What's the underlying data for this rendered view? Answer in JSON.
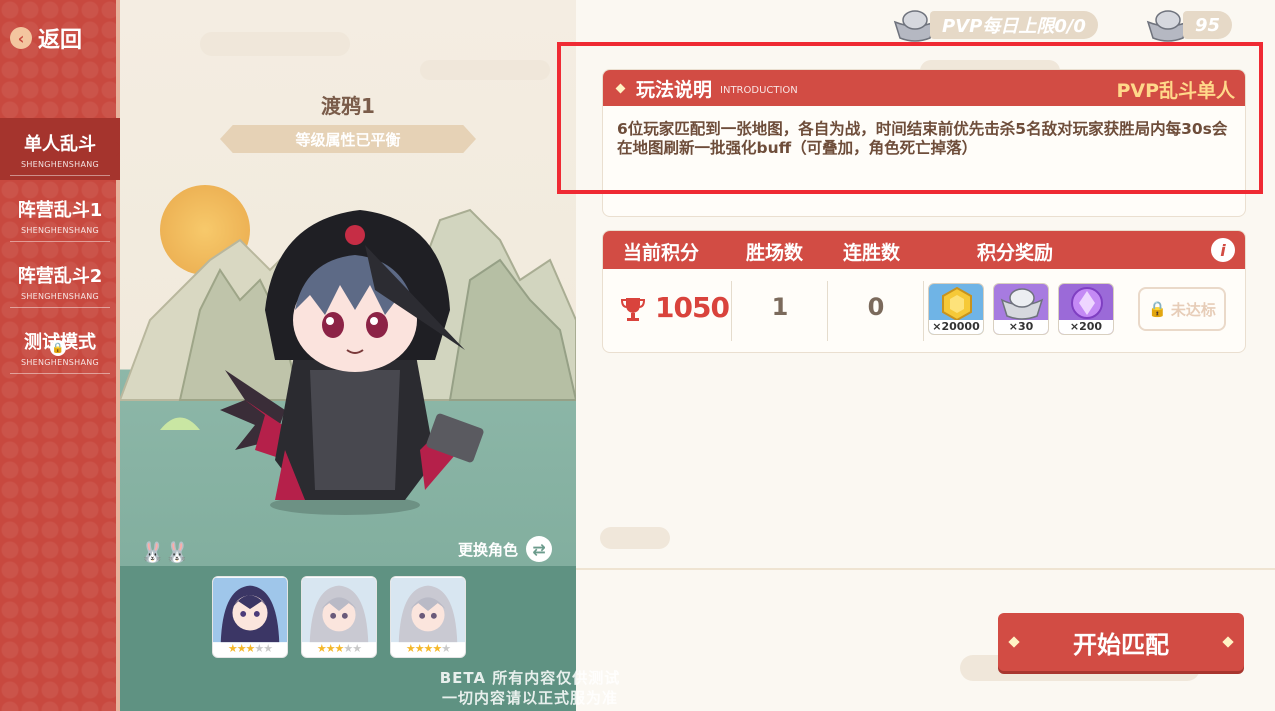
{
  "sidebar": {
    "back_label": "返回",
    "modes": [
      {
        "label": "单人乱斗",
        "sub": "SHENGHENSHANG",
        "active": true
      },
      {
        "label": "阵营乱斗1",
        "sub": "SHENGHENSHANG",
        "active": false
      },
      {
        "label": "阵营乱斗2",
        "sub": "SHENGHENSHANG",
        "active": false
      },
      {
        "label": "测试模式",
        "sub": "SHENGHENSHANG",
        "active": false,
        "locked": true
      }
    ]
  },
  "character": {
    "name": "渡鸦1",
    "balance_note": "等级属性已平衡",
    "switch_label": "更换角色",
    "roster": [
      {
        "stars_on": 3,
        "stars_total": 5
      },
      {
        "stars_on": 3,
        "stars_total": 5
      },
      {
        "stars_on": 4,
        "stars_total": 5
      }
    ]
  },
  "watermark": {
    "line1": "BETA 所有内容仅供测试",
    "line2": "一切内容请以正式服为准"
  },
  "currency": {
    "pvp_limit": "PVP每日上限0/0",
    "silver": "95"
  },
  "intro": {
    "title": "玩法说明",
    "subtitle": "INTRODUCTION",
    "mode": "PVP乱斗单人",
    "text": "6位玩家匹配到一张地图，各自为战，时间结束前优先击杀5名敌对玩家获胜局内每30s会在地图刷新一批强化buff（可叠加，角色死亡掉落）"
  },
  "score": {
    "headers": {
      "points": "当前积分",
      "wins": "胜场数",
      "streak": "连胜数",
      "rewards": "积分奖励"
    },
    "points": "1050",
    "wins": "1",
    "streak": "0",
    "rewards": [
      {
        "count": "×20000",
        "icon": "gold-coin-icon"
      },
      {
        "count": "×30",
        "icon": "silver-ingot-icon"
      },
      {
        "count": "×200",
        "icon": "purple-crystal-icon"
      }
    ],
    "status_label": "未达标"
  },
  "start_button": "开始匹配",
  "colors": {
    "primary_red": "#d24c44",
    "sidebar_red": "#c8493f",
    "score_red": "#d9433c",
    "highlight_frame": "#ef2a33"
  }
}
